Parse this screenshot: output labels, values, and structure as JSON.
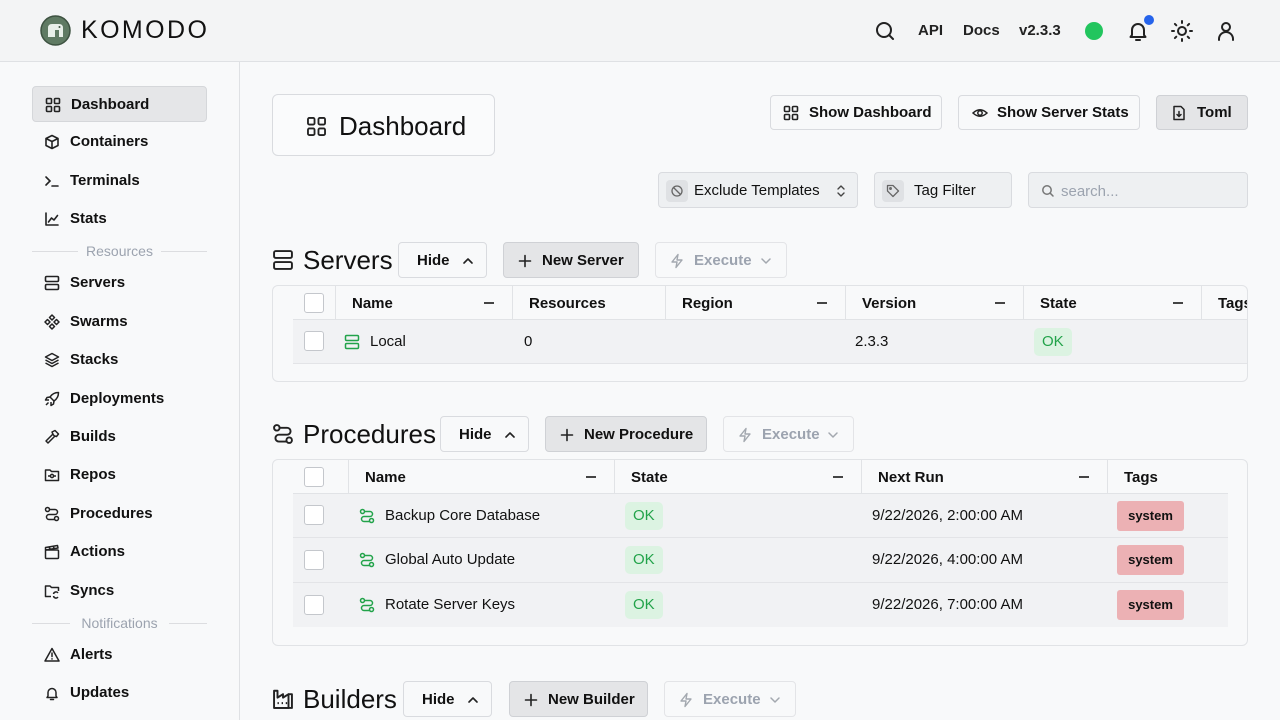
{
  "header": {
    "brand": "KOMODO",
    "api_label": "API",
    "docs_label": "Docs",
    "version": "v2.3.3",
    "status_color": "#22c55e",
    "icons": [
      "search-icon",
      "bell-icon",
      "sun-icon",
      "user-icon"
    ]
  },
  "sidebar": {
    "items": [
      {
        "label": "Dashboard",
        "icon": "layout-grid-icon",
        "active": true
      },
      {
        "label": "Containers",
        "icon": "box-icon"
      },
      {
        "label": "Terminals",
        "icon": "terminal-icon"
      },
      {
        "label": "Stats",
        "icon": "chart-line-icon"
      },
      {
        "label": "Servers",
        "icon": "server-icon"
      },
      {
        "label": "Swarms",
        "icon": "component-icon"
      },
      {
        "label": "Stacks",
        "icon": "layers-icon"
      },
      {
        "label": "Deployments",
        "icon": "rocket-icon"
      },
      {
        "label": "Builds",
        "icon": "hammer-icon"
      },
      {
        "label": "Repos",
        "icon": "folder-git-icon"
      },
      {
        "label": "Procedures",
        "icon": "route-icon"
      },
      {
        "label": "Actions",
        "icon": "clapperboard-icon"
      },
      {
        "label": "Syncs",
        "icon": "folder-sync-icon"
      },
      {
        "label": "Alerts",
        "icon": "alert-triangle-icon"
      },
      {
        "label": "Updates",
        "icon": "bell-icon"
      }
    ],
    "sections": {
      "resources": "Resources",
      "notifications": "Notifications"
    }
  },
  "page": {
    "title": "Dashboard",
    "show_dashboard_label": "Show Dashboard",
    "show_server_stats_label": "Show Server Stats",
    "toml_label": "Toml"
  },
  "filters": {
    "template_select": "Exclude Templates",
    "tag_filter": "Tag Filter",
    "search_placeholder": "search..."
  },
  "servers": {
    "title": "Servers",
    "hide_label": "Hide",
    "new_label": "New Server",
    "execute_label": "Execute",
    "columns": [
      "Name",
      "Resources",
      "Region",
      "Version",
      "State",
      "Tags"
    ],
    "rows": [
      {
        "name": "Local",
        "resources": "0",
        "region": "",
        "version": "2.3.3",
        "state": "OK"
      }
    ]
  },
  "procedures": {
    "title": "Procedures",
    "hide_label": "Hide",
    "new_label": "New Procedure",
    "execute_label": "Execute",
    "columns": [
      "Name",
      "State",
      "Next Run",
      "Tags"
    ],
    "rows": [
      {
        "name": "Backup Core Database",
        "state": "OK",
        "next_run": "9/22/2026, 2:00:00 AM",
        "tag": "system"
      },
      {
        "name": "Global Auto Update",
        "state": "OK",
        "next_run": "9/22/2026, 4:00:00 AM",
        "tag": "system"
      },
      {
        "name": "Rotate Server Keys",
        "state": "OK",
        "next_run": "9/22/2026, 7:00:00 AM",
        "tag": "system"
      }
    ]
  },
  "builders": {
    "title": "Builders",
    "hide_label": "Hide",
    "new_label": "New Builder",
    "execute_label": "Execute"
  },
  "colors": {
    "accent_ok": "#22a34a",
    "tag_system": "#ecb1b4",
    "notif_dot": "#2563eb"
  }
}
